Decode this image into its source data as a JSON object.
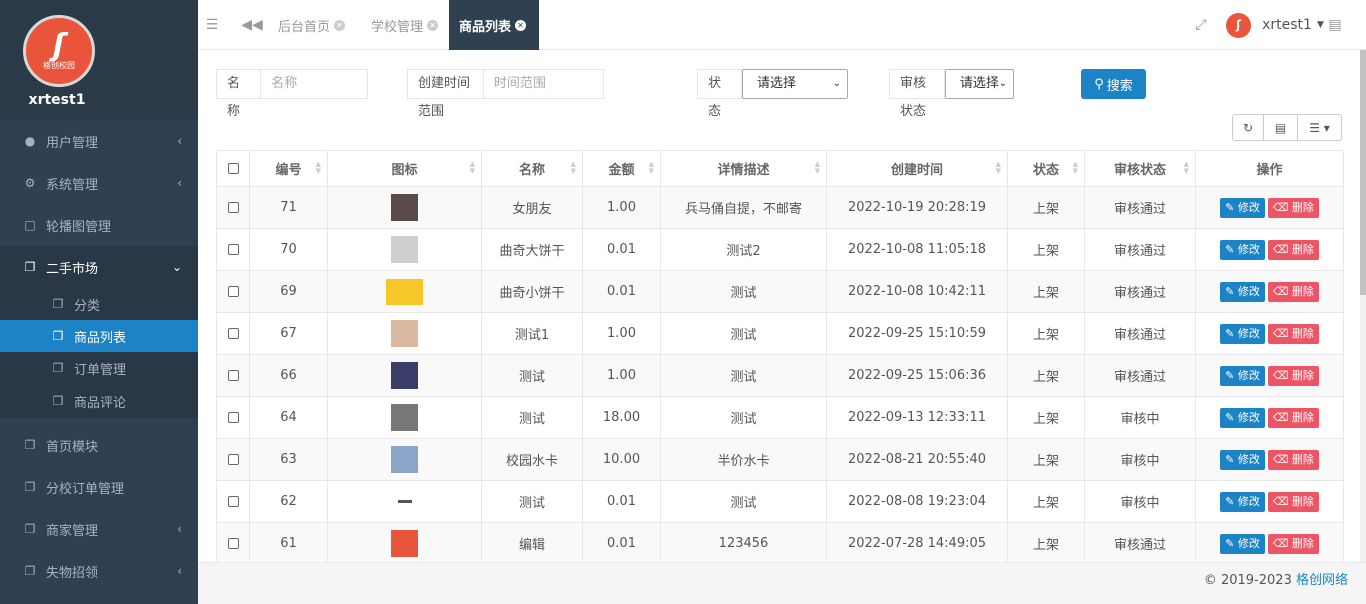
{
  "sidebar": {
    "username": "xrtest1",
    "logo_text": "格创校园",
    "menu": [
      {
        "label": "用户管理",
        "icon": "user-icon"
      },
      {
        "label": "系统管理",
        "icon": "gears-icon"
      },
      {
        "label": "轮播图管理",
        "icon": "monitor-icon"
      },
      {
        "label": "二手市场",
        "icon": "copy-icon"
      }
    ],
    "sub": [
      {
        "label": "分类"
      },
      {
        "label": "商品列表"
      },
      {
        "label": "订单管理"
      },
      {
        "label": "商品评论"
      }
    ],
    "menu2": [
      {
        "label": "首页模块"
      },
      {
        "label": "分校订单管理"
      },
      {
        "label": "商家管理"
      },
      {
        "label": "失物招领"
      }
    ]
  },
  "topbar": {
    "tabs": [
      {
        "label": "后台首页"
      },
      {
        "label": "学校管理"
      },
      {
        "label": "商品列表"
      }
    ],
    "user": "xrtest1"
  },
  "search": {
    "name_label": "名称",
    "name_placeholder": "名称",
    "time_label": "创建时间范围",
    "time_placeholder": "时间范围",
    "status_label": "状态",
    "status_value": "请选择",
    "audit_label": "审核状态",
    "audit_value": "请选择",
    "search_button": "搜索"
  },
  "table": {
    "headers": [
      "编号",
      "图标",
      "名称",
      "金额",
      "详情描述",
      "创建时间",
      "状态",
      "审核状态",
      "操作"
    ],
    "edit_label": "修改",
    "delete_label": "删除",
    "rows": [
      {
        "id": "71",
        "name": "女朋友",
        "amount": "1.00",
        "desc": "兵马俑自提，不邮寄",
        "time": "2022-10-19 20:28:19",
        "status": "上架",
        "audit": "审核通过",
        "thumb": "#5a4a4a"
      },
      {
        "id": "70",
        "name": "曲奇大饼干",
        "amount": "0.01",
        "desc": "测试2",
        "time": "2022-10-08 11:05:18",
        "status": "上架",
        "audit": "审核通过",
        "thumb": "#cfcfcf"
      },
      {
        "id": "69",
        "name": "曲奇小饼干",
        "amount": "0.01",
        "desc": "测试",
        "time": "2022-10-08 10:42:11",
        "status": "上架",
        "audit": "审核通过",
        "thumb": "#f7c72a"
      },
      {
        "id": "67",
        "name": "测试1",
        "amount": "1.00",
        "desc": "测试",
        "time": "2022-09-25 15:10:59",
        "status": "上架",
        "audit": "审核通过",
        "thumb": "#d9b9a0"
      },
      {
        "id": "66",
        "name": "测试",
        "amount": "1.00",
        "desc": "测试",
        "time": "2022-09-25 15:06:36",
        "status": "上架",
        "audit": "审核通过",
        "thumb": "#3d3d6a"
      },
      {
        "id": "64",
        "name": "测试",
        "amount": "18.00",
        "desc": "测试",
        "time": "2022-09-13 12:33:11",
        "status": "上架",
        "audit": "审核中",
        "thumb": "#777777"
      },
      {
        "id": "63",
        "name": "校园水卡",
        "amount": "10.00",
        "desc": "半价水卡",
        "time": "2022-08-21 20:55:40",
        "status": "上架",
        "audit": "审核中",
        "thumb": "#8aa5c8"
      },
      {
        "id": "62",
        "name": "测试",
        "amount": "0.01",
        "desc": "测试",
        "time": "2022-08-08 19:23:04",
        "status": "上架",
        "audit": "审核中",
        "thumb": "#ffffff"
      },
      {
        "id": "61",
        "name": "编辑",
        "amount": "0.01",
        "desc": "123456",
        "time": "2022-07-28 14:49:05",
        "status": "上架",
        "audit": "审核通过",
        "thumb": "#e8553b"
      }
    ]
  },
  "footer": {
    "copyright": "© 2019-2023",
    "company": "格创网络"
  }
}
